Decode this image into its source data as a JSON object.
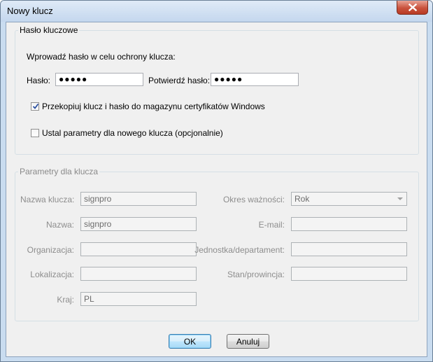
{
  "window": {
    "title": "Nowy klucz"
  },
  "password_group": {
    "legend": "Hasło kluczowe",
    "instruction": "Wprowadź hasło w celu ochrony klucza:",
    "password_label": "Hasło:",
    "password_value": "●●●●●",
    "confirm_label": "Potwierdź hasło:",
    "confirm_value": "●●●●●",
    "copy_checkbox_label": "Przekopiuj klucz i hasło do magazynu certyfikatów Windows",
    "copy_checkbox_checked": true,
    "params_checkbox_label": "Ustal parametry dla nowego klucza (opcjonalnie)",
    "params_checkbox_checked": false
  },
  "params_group": {
    "legend": "Parametry dla klucza",
    "key_name_label": "Nazwa klucza:",
    "key_name_value": "signpro",
    "validity_label": "Okres ważności:",
    "validity_value": "Rok",
    "name_label": "Nazwa:",
    "name_value": "signpro",
    "email_label": "E-mail:",
    "email_value": "",
    "organization_label": "Organizacja:",
    "organization_value": "",
    "unit_label": "Jednostka/departament:",
    "unit_value": "",
    "locality_label": "Lokalizacja:",
    "locality_value": "",
    "state_label": "Stan/prowincja:",
    "state_value": "",
    "country_label": "Kraj:",
    "country_value": "PL"
  },
  "buttons": {
    "ok": "OK",
    "cancel": "Anuluj"
  }
}
